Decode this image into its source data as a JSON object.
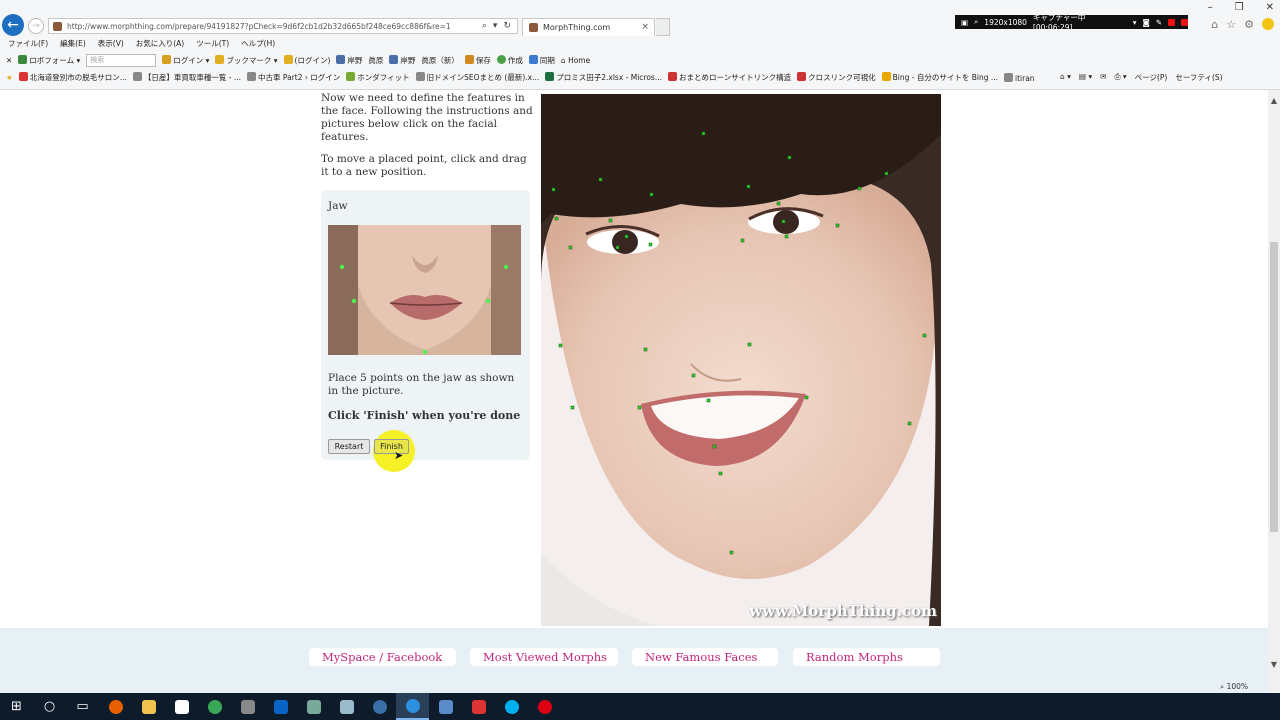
{
  "browser": {
    "url": "http://www.morphthing.com/prepare/94191827?pCheck=9d6f2cb1d2b32d665bf248ce69cc886f&re=1",
    "tab_title": "MorphThing.com",
    "tab_close": "×",
    "menu": [
      "ファイル(F)",
      "編集(E)",
      "表示(V)",
      "お気に入り(A)",
      "ツール(T)",
      "ヘルプ(H)"
    ],
    "command_bar": {
      "robo_form": "ロボフォーム",
      "search_placeholder": "検索",
      "login": "ログイン",
      "bookmark": "ブックマーク",
      "login2": "(ログイン)",
      "item1": "岸野",
      "item2": "眞原",
      "item3": "岸野",
      "item4": "眞原（新）",
      "save": "保存",
      "create": "作成",
      "sync": "同期",
      "home": "Home"
    },
    "favorites": [
      "北海道登別市の脱毛サロン...",
      "【日産】車買取車種一覧 - ...",
      "中古車 Part2 › ログイン",
      "ホンダフィット",
      "旧ドメインSEOまとめ (最新).x...",
      "プロミス田子2.xlsx - Micros...",
      "おまとめローンサイトリンク構造",
      "クロスリンク可視化",
      "Bing - 自分のサイトを Bing ...",
      "itiran"
    ],
    "ie_tools": [
      "ページ(P)",
      "セーフティ(S)"
    ],
    "capture": {
      "resolution": "1920x1080",
      "status": "キャプチャー中 [00:06:29]"
    },
    "zoom": "100%"
  },
  "page": {
    "intro": [
      "Now we need to define the features in the face. Following the instructions and pictures below click on the facial features.",
      "To move a placed point, click and drag it to a new position."
    ],
    "panel": {
      "title": "Jaw",
      "hint": "Place 5 points on the jaw as shown in the picture.",
      "finish_hint": "Click 'Finish' when you're done",
      "restart_label": "Restart",
      "finish_label": "Finish"
    },
    "watermark": "www.MorphThing.com",
    "footer_tabs": [
      "MySpace / Facebook",
      "Most Viewed Morphs",
      "New Famous Faces",
      "Random Morphs"
    ]
  },
  "colors": {
    "accent_link": "#c0267a",
    "marker": "#2fd12f",
    "panel_bg": "#eef3f6",
    "footer_bg": "#e7f1f5",
    "highlight": "#f6f01a"
  }
}
